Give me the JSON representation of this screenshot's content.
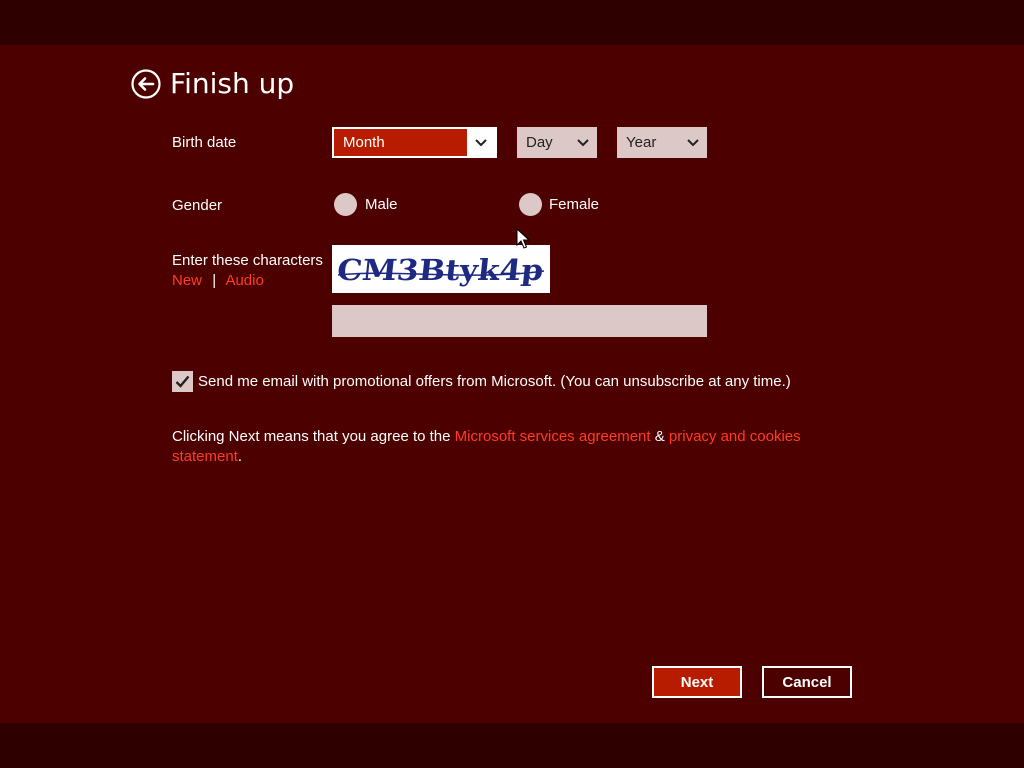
{
  "header": {
    "title": "Finish up",
    "back_icon": "back-arrow-circle-icon"
  },
  "birth_date": {
    "label": "Birth date",
    "month": "Month",
    "day": "Day",
    "year": "Year"
  },
  "gender": {
    "label": "Gender",
    "male": "Male",
    "female": "Female"
  },
  "captcha": {
    "label": "Enter these characters",
    "new_link": "New",
    "separator": "|",
    "audio_link": "Audio",
    "image_text": "CM3Btyk4p",
    "input_value": ""
  },
  "promo": {
    "checked": true,
    "label": "Send me email with promotional offers from Microsoft. (You can unsubscribe at any time.)"
  },
  "agreement": {
    "prefix": "Clicking Next means that you agree to the ",
    "services_link": "Microsoft services agreement",
    "ampersand": " & ",
    "privacy_link": "privacy and cookies statement",
    "suffix": "."
  },
  "buttons": {
    "next": "Next",
    "cancel": "Cancel"
  },
  "colors": {
    "background": "#4d0000",
    "band": "#2e0000",
    "accent": "#b81c00",
    "link": "#ff3b24",
    "field": "#ddc8c8"
  }
}
